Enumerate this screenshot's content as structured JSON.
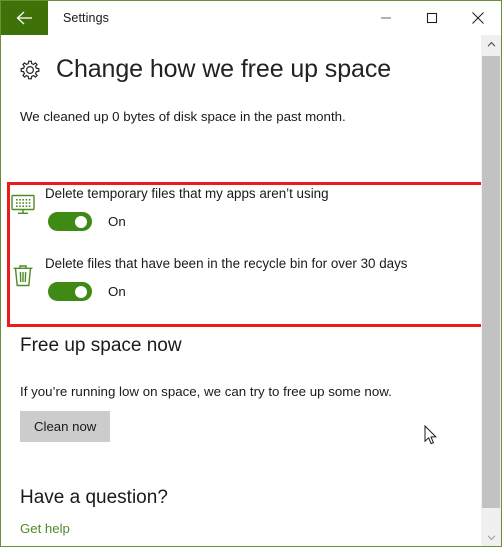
{
  "window": {
    "title": "Settings",
    "back_icon": "back-arrow-icon",
    "controls": {
      "minimize": "minimize-icon",
      "maximize": "maximize-icon",
      "close": "close-icon"
    },
    "accent_color": "#3f7109",
    "border_color": "#6b8e3a"
  },
  "page": {
    "icon": "gear-icon",
    "title": "Change how we free up space",
    "subtitle": "We cleaned up 0 bytes of disk space in the past month."
  },
  "highlight": {
    "color": "#ee1b1b",
    "label": "red-annotation-box"
  },
  "settings": [
    {
      "icon": "monitor-icon",
      "label": "Delete temporary files that my apps aren’t using",
      "toggle_state": "On",
      "toggle_on": true
    },
    {
      "icon": "recycle-bin-icon",
      "label": "Delete files that have been in the recycle bin for over 30 days",
      "toggle_state": "On",
      "toggle_on": true
    }
  ],
  "free_up_space": {
    "heading": "Free up space now",
    "description": "If you’re running low on space, we can try to free up some now.",
    "button_label": "Clean now"
  },
  "question": {
    "heading": "Have a question?",
    "link_label": "Get help",
    "link_color": "#4e8a26"
  },
  "scrollbar": {
    "up_icon": "scroll-up-arrow-icon",
    "down_icon": "scroll-down-arrow-icon",
    "thumb": "scrollbar-thumb"
  },
  "toggle_color": "#3f8a14",
  "icon_color": "#4e8a26"
}
